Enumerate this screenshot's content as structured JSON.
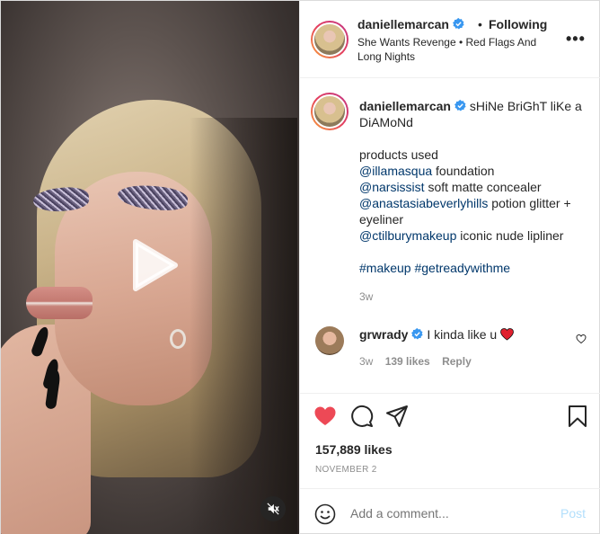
{
  "header": {
    "username": "daniellemarcan",
    "separator": "•",
    "follow_status": "Following",
    "song": "She Wants Revenge • Red Flags And Long Nights",
    "more": "•••"
  },
  "caption": {
    "username": "daniellemarcan",
    "text_start": "sHiNe BriGhT liKe a DiAMoNd",
    "lines": [
      {
        "plain_before": "products used",
        "mention": "",
        "plain_after": ""
      },
      {
        "plain_before": "",
        "mention": "@illamasqua",
        "plain_after": " foundation"
      },
      {
        "plain_before": "",
        "mention": "@narsissist",
        "plain_after": " soft matte concealer"
      },
      {
        "plain_before": "",
        "mention": "@anastasiabeverlyhills",
        "plain_after": " potion glitter + eyeliner"
      },
      {
        "plain_before": "",
        "mention": "@ctilburymakeup",
        "plain_after": " iconic nude lipliner"
      }
    ],
    "tags": [
      "#makeup",
      "#getreadywithme"
    ],
    "time": "3w"
  },
  "comment": {
    "username": "grwrady",
    "text": "I kinda like u",
    "time": "3w",
    "likes": "139 likes",
    "reply": "Reply"
  },
  "actions": {
    "likes_count": "157,889 likes",
    "date": "NOVEMBER 2"
  },
  "add_comment": {
    "placeholder": "Add a comment...",
    "post": "Post"
  },
  "colors": {
    "link": "#00376b",
    "verified": "#3897f0",
    "like_red": "#ed4956",
    "post_disabled": "#b2dffc"
  }
}
